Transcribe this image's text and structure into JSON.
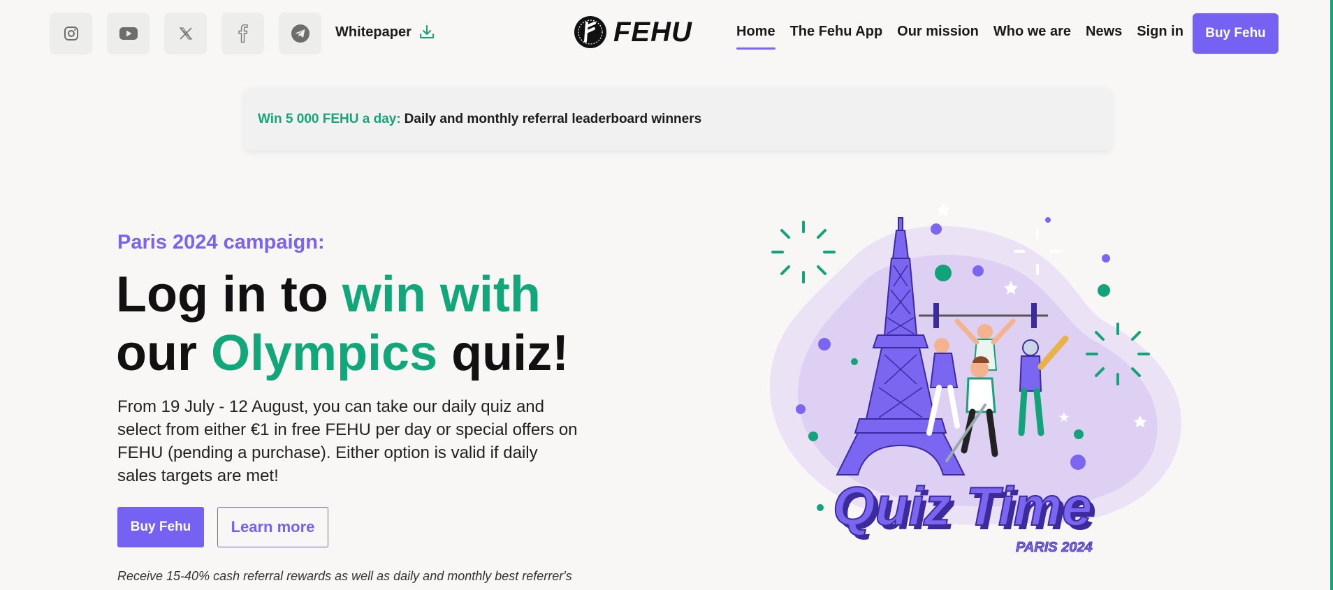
{
  "header": {
    "socials": [
      {
        "icon": "instagram-icon"
      },
      {
        "icon": "youtube-icon"
      },
      {
        "icon": "x-icon"
      },
      {
        "icon": "facebook-icon"
      },
      {
        "icon": "telegram-icon"
      }
    ],
    "whitepaper_label": "Whitepaper",
    "logo_text": "FEHU",
    "nav": [
      {
        "label": "Home",
        "active": true
      },
      {
        "label": "The Fehu App"
      },
      {
        "label": "Our mission"
      },
      {
        "label": "Who we are"
      },
      {
        "label": "News"
      },
      {
        "label": "Sign in"
      }
    ],
    "buy_label": "Buy Fehu"
  },
  "banner": {
    "highlight": "Win 5 000 FEHU a day:",
    "text": "Daily and monthly referral leaderboard winners"
  },
  "hero": {
    "eyebrow": "Paris 2024 campaign:",
    "headline": {
      "part1": "Log in to ",
      "part2": "win with",
      "part3": "our ",
      "part4": "Olympics",
      "part5": " quiz!"
    },
    "description": "From 19 July - 12 August, you can take our daily quiz and select from either €1 in free FEHU per day or special offers on FEHU (pending a purchase). Either option is valid if daily sales targets are met!",
    "buy_label": "Buy Fehu",
    "learn_label": "Learn more",
    "note": "Receive 15-40% cash referral rewards as well as daily and monthly best referrer's"
  },
  "illustration": {
    "title": "Quiz Time",
    "subtitle": "PARIS 2024"
  },
  "colors": {
    "accent": "#7561f2",
    "green": "#11a77a",
    "background": "#f8f7f5"
  }
}
